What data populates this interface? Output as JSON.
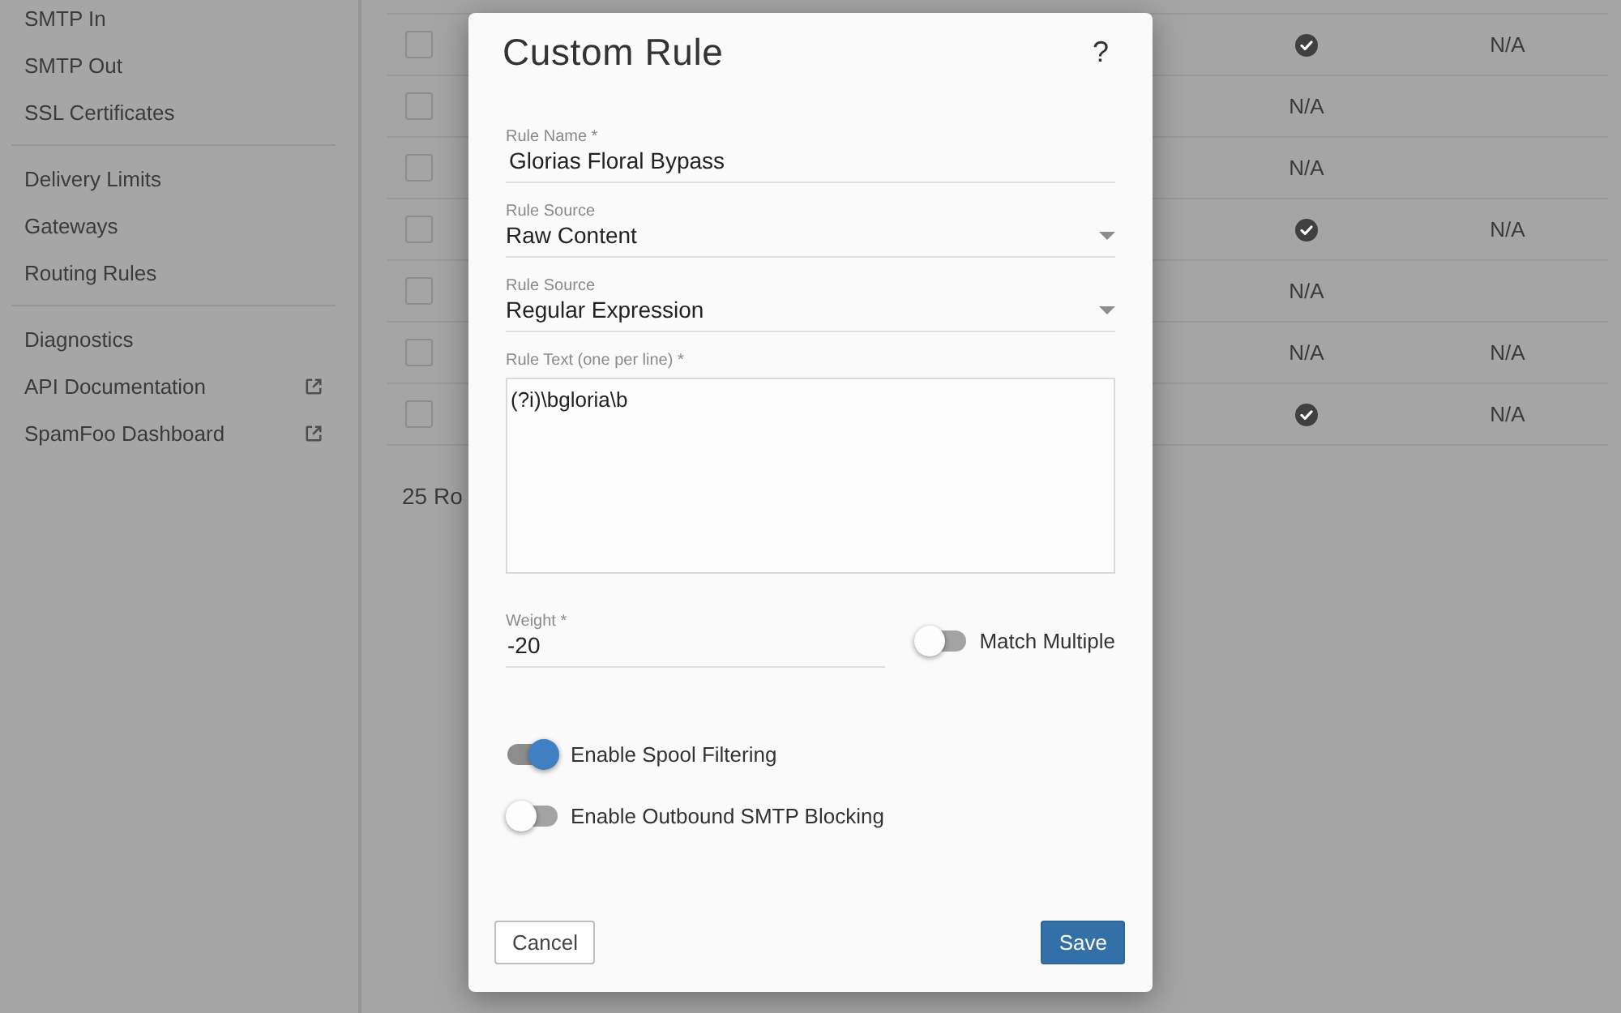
{
  "sidebar": {
    "groups": [
      {
        "items": [
          {
            "label": "SMTP In",
            "external": false
          },
          {
            "label": "SMTP Out",
            "external": false
          },
          {
            "label": "SSL Certificates",
            "external": false
          }
        ]
      },
      {
        "items": [
          {
            "label": "Delivery Limits",
            "external": false
          },
          {
            "label": "Gateways",
            "external": false
          },
          {
            "label": "Routing Rules",
            "external": false
          }
        ]
      },
      {
        "items": [
          {
            "label": "Diagnostics",
            "external": false
          },
          {
            "label": "API Documentation",
            "external": true
          },
          {
            "label": "SpamFoo Dashboard",
            "external": true
          }
        ]
      }
    ]
  },
  "table": {
    "rows": [
      {
        "checked": false,
        "column_3": {
          "kind": "check"
        },
        "column_4": "N/A"
      },
      {
        "checked": false,
        "column_3": {
          "kind": "text",
          "text": "N/A"
        }
      },
      {
        "checked": false,
        "column_3": {
          "kind": "text",
          "text": "N/A"
        }
      },
      {
        "checked": false,
        "column_3": {
          "kind": "check"
        },
        "column_4": "N/A"
      },
      {
        "checked": false,
        "column_3": {
          "kind": "text",
          "text": "N/A"
        }
      },
      {
        "checked": false,
        "column_3": {
          "kind": "text",
          "text": "N/A"
        },
        "column_4": "N/A"
      },
      {
        "checked": false,
        "column_3": {
          "kind": "check"
        },
        "column_4": "N/A"
      }
    ],
    "footer": "25 Ro"
  },
  "dialog": {
    "title": "Custom Rule",
    "help": "?",
    "fields": [
      {
        "kind": "text",
        "label": "Rule Name *",
        "value": "Glorias Floral Bypass"
      },
      {
        "kind": "select",
        "label": "Rule Source",
        "value": "Raw Content"
      },
      {
        "kind": "select",
        "label": "Rule Source",
        "value": "Regular Expression"
      },
      {
        "kind": "textarea",
        "label": "Rule Text (one per line) *",
        "value": "(?i)\\bgloria\\b"
      }
    ],
    "weight": {
      "label": "Weight *",
      "value": "-20"
    },
    "match_multiple": {
      "label": "Match Multiple",
      "on": false
    },
    "toggles": [
      {
        "label": "Enable Spool Filtering",
        "on": true
      },
      {
        "label": "Enable Outbound SMTP Blocking",
        "on": false
      }
    ],
    "buttons": [
      {
        "label": "Cancel",
        "kind": "secondary"
      },
      {
        "label": "Save",
        "kind": "primary"
      }
    ]
  }
}
